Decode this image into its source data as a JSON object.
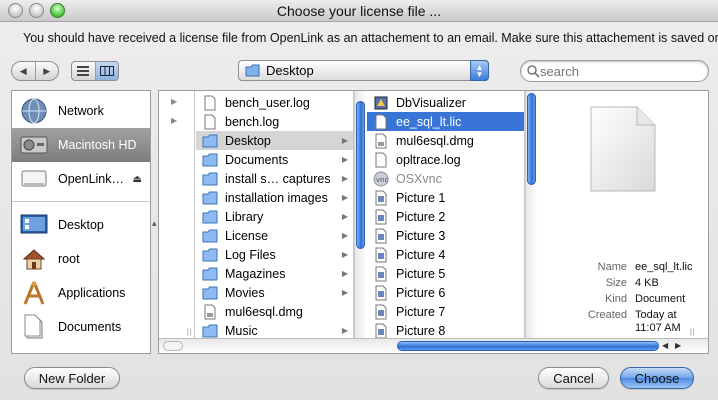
{
  "window": {
    "title": "Choose your license file ..."
  },
  "message": "You should have received a license file from OpenLink as an attachement to an email. Make sure this attachement is saved on",
  "toolbar": {
    "location": "Desktop",
    "search_placeholder": "search"
  },
  "sidebar": {
    "devices": [
      {
        "label": "Network",
        "icon": "network-globe-icon"
      },
      {
        "label": "Macintosh HD",
        "icon": "hard-drive-icon",
        "selected": true
      },
      {
        "label": "OpenLink…",
        "icon": "external-drive-icon",
        "eject": "⏏"
      }
    ],
    "places": [
      {
        "label": "Desktop",
        "icon": "desktop-icon"
      },
      {
        "label": "root",
        "icon": "home-icon"
      },
      {
        "label": "Applications",
        "icon": "applications-icon"
      },
      {
        "label": "Documents",
        "icon": "documents-icon"
      }
    ]
  },
  "columns": {
    "col2": [
      {
        "label": "bench_user.log",
        "icon": "doc-icon"
      },
      {
        "label": "bench.log",
        "icon": "doc-icon"
      },
      {
        "label": "Desktop",
        "icon": "folder-icon",
        "folder": true,
        "selected": true
      },
      {
        "label": "Documents",
        "icon": "folder-icon",
        "folder": true
      },
      {
        "label": "install s… captures",
        "icon": "folder-icon",
        "folder": true
      },
      {
        "label": "installation images",
        "icon": "folder-icon",
        "folder": true
      },
      {
        "label": "Library",
        "icon": "folder-icon",
        "folder": true
      },
      {
        "label": "License",
        "icon": "folder-icon",
        "folder": true
      },
      {
        "label": "Log Files",
        "icon": "folder-icon",
        "folder": true
      },
      {
        "label": "Magazines",
        "icon": "folder-icon",
        "folder": true
      },
      {
        "label": "Movies",
        "icon": "folder-icon",
        "folder": true
      },
      {
        "label": "mul6esql.dmg",
        "icon": "disk-image-icon"
      },
      {
        "label": "Music",
        "icon": "folder-icon",
        "folder": true
      }
    ],
    "col3": [
      {
        "label": "DbVisualizer",
        "icon": "app-icon"
      },
      {
        "label": "ee_sql_lt.lic",
        "icon": "doc-icon",
        "selected": true
      },
      {
        "label": "mul6esql.dmg",
        "icon": "disk-image-icon"
      },
      {
        "label": "opltrace.log",
        "icon": "doc-icon"
      },
      {
        "label": "OSXvnc",
        "icon": "vnc-app-icon",
        "dimmed": true
      },
      {
        "label": "Picture 1",
        "icon": "picture-icon"
      },
      {
        "label": "Picture 2",
        "icon": "picture-icon"
      },
      {
        "label": "Picture 3",
        "icon": "picture-icon"
      },
      {
        "label": "Picture 4",
        "icon": "picture-icon"
      },
      {
        "label": "Picture 5",
        "icon": "picture-icon"
      },
      {
        "label": "Picture 6",
        "icon": "picture-icon"
      },
      {
        "label": "Picture 7",
        "icon": "picture-icon"
      },
      {
        "label": "Picture 8",
        "icon": "picture-icon"
      }
    ]
  },
  "preview": {
    "name_label": "Name",
    "name": "ee_sql_lt.lic",
    "size_label": "Size",
    "size": "4 KB",
    "kind_label": "Kind",
    "kind": "Document",
    "created_label": "Created",
    "created_line1": "Today at",
    "created_line2": "11:07 AM"
  },
  "buttons": {
    "new_folder": "New Folder",
    "cancel": "Cancel",
    "choose": "Choose"
  },
  "colors": {
    "selection": "#3875d7",
    "selection_inactive": "#d5d5d5"
  }
}
